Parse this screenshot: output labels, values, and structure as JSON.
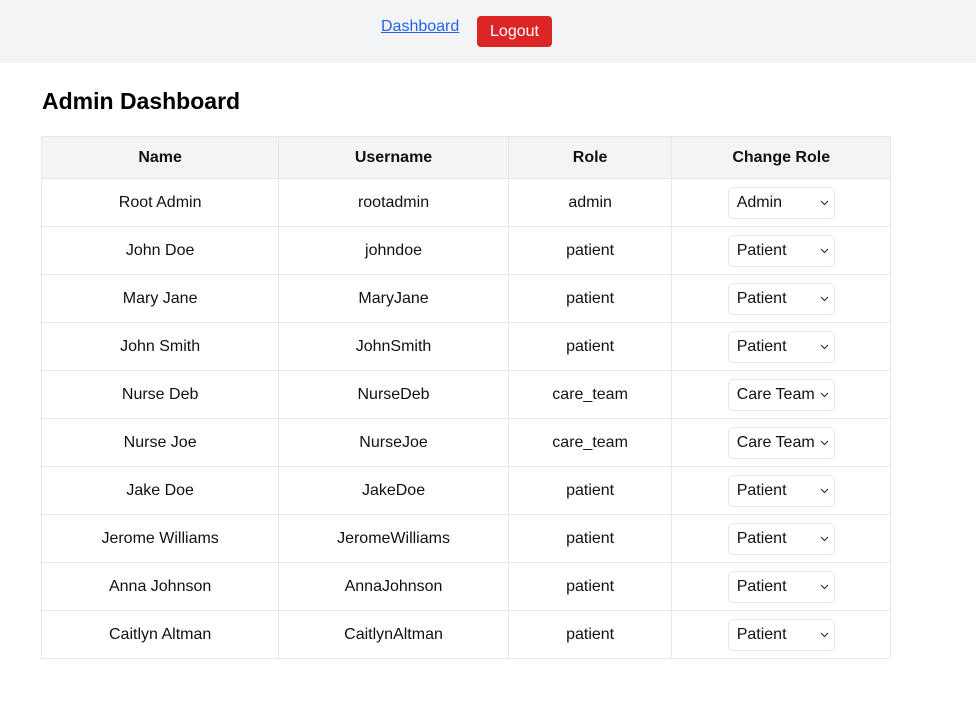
{
  "nav": {
    "dashboard_label": "Dashboard",
    "logout_label": "Logout"
  },
  "page": {
    "title": "Admin Dashboard"
  },
  "table": {
    "headers": [
      "Name",
      "Username",
      "Role",
      "Change Role"
    ],
    "rows": [
      {
        "name": "Root Admin",
        "username": "rootadmin",
        "role": "admin",
        "selected": "Admin"
      },
      {
        "name": "John Doe",
        "username": "johndoe",
        "role": "patient",
        "selected": "Patient"
      },
      {
        "name": "Mary Jane",
        "username": "MaryJane",
        "role": "patient",
        "selected": "Patient"
      },
      {
        "name": "John Smith",
        "username": "JohnSmith",
        "role": "patient",
        "selected": "Patient"
      },
      {
        "name": "Nurse Deb",
        "username": "NurseDeb",
        "role": "care_team",
        "selected": "Care Team"
      },
      {
        "name": "Nurse Joe",
        "username": "NurseJoe",
        "role": "care_team",
        "selected": "Care Team"
      },
      {
        "name": "Jake Doe",
        "username": "JakeDoe",
        "role": "patient",
        "selected": "Patient"
      },
      {
        "name": "Jerome Williams",
        "username": "JeromeWilliams",
        "role": "patient",
        "selected": "Patient"
      },
      {
        "name": "Anna Johnson",
        "username": "AnnaJohnson",
        "role": "patient",
        "selected": "Patient"
      },
      {
        "name": "Caitlyn Altman",
        "username": "CaitlynAltman",
        "role": "patient",
        "selected": "Patient"
      }
    ]
  },
  "colors": {
    "topbar_bg": "#f3f4f6",
    "link": "#2563eb",
    "logout_bg": "#dc2626",
    "border": "#e5e7eb"
  },
  "icons": {
    "select_chevron": "chevron-down-icon"
  }
}
